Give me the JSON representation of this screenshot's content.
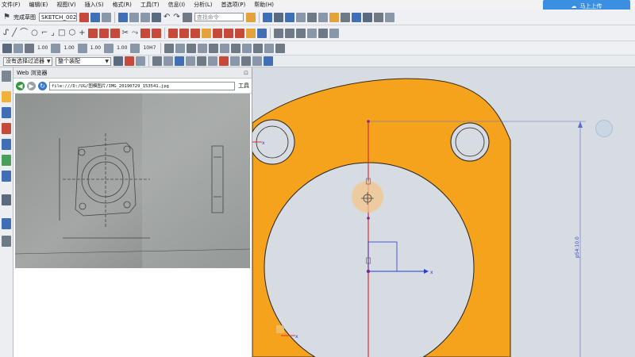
{
  "menubar": {
    "items": [
      "文件(F)",
      "编辑(E)",
      "视图(V)",
      "插入(S)",
      "格式(R)",
      "工具(T)",
      "信息(I)",
      "分析(L)",
      "首选项(P)",
      "帮助(H)"
    ]
  },
  "toolbar": {
    "finish_sketch": "完成草图",
    "sketch_name": "SKETCH_002",
    "command_search_placeholder": "查找命令",
    "selection_filter": "没有选择过滤器",
    "assembly_scope": "整个装配",
    "numbers": [
      "1.00",
      "1.00",
      "1.00",
      "1.00",
      "10H7"
    ]
  },
  "cloud_button": {
    "label": "马上上传"
  },
  "web_panel": {
    "title": "Web 浏览器",
    "url": "file:///D:/UG/图模图片/IMG_20190729_153541.jpg",
    "tools_label": "工具"
  },
  "canvas": {
    "dimension_label": "p54:10.0",
    "axis_label": "x",
    "colors": {
      "part": "#f5a31d",
      "axis_red": "#e0303a",
      "axis_blue": "#2a3dcf",
      "background": "#d7dbe2"
    }
  },
  "icons": [
    "sketch-flag-icon",
    "save-icon",
    "undo-icon",
    "redo-icon",
    "profile-icon",
    "line-icon",
    "arc-icon",
    "circle-icon",
    "fillet-icon",
    "chamfer-icon",
    "rectangle-icon",
    "polygon-icon",
    "point-icon",
    "trim-icon",
    "extend-icon",
    "constraint-icon",
    "snap-icon",
    "back-icon",
    "forward-icon",
    "refresh-icon",
    "resource-bar-icons"
  ]
}
